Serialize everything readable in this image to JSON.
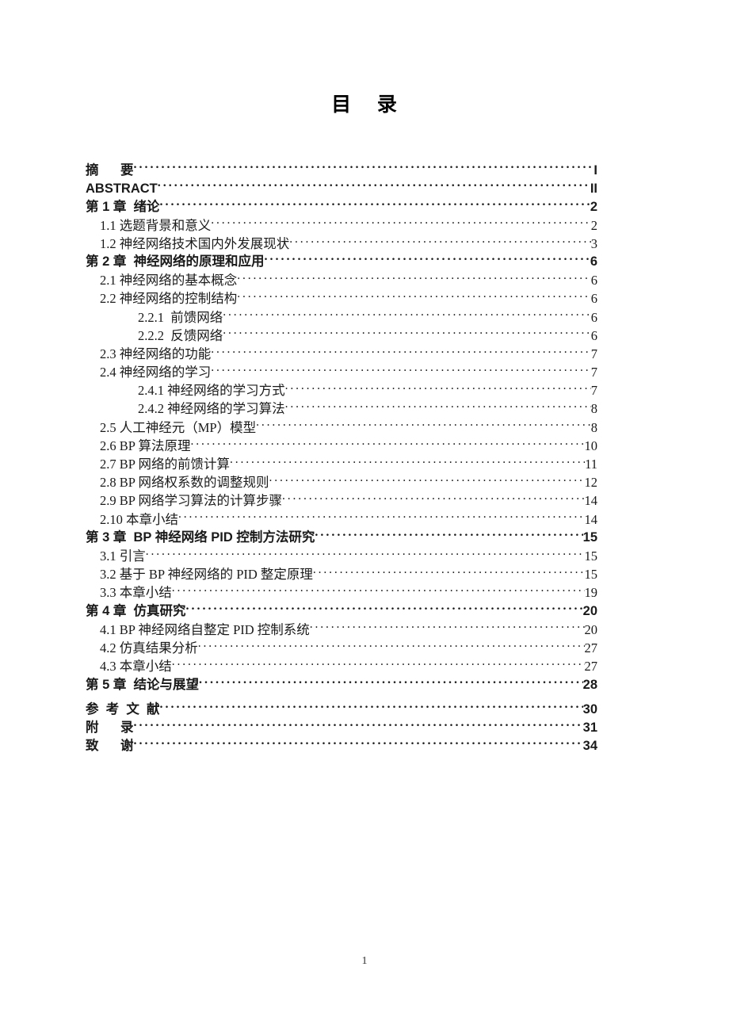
{
  "document": {
    "title": "目    录",
    "folio": "1"
  },
  "toc": {
    "entries": [
      {
        "label": "摘      要",
        "page": "I",
        "level": "front"
      },
      {
        "label": "ABSTRACT",
        "page": "II",
        "level": "front"
      },
      {
        "label": "第 1 章  绪论",
        "page": "2",
        "level": "1"
      },
      {
        "label": "1.1 选题背景和意义",
        "page": "2",
        "level": "2"
      },
      {
        "label": "1.2 神经网络技术国内外发展现状",
        "page": "3",
        "level": "2"
      },
      {
        "label": "第 2 章  神经网络的原理和应用",
        "page": "6",
        "level": "1"
      },
      {
        "label": "2.1 神经网络的基本概念",
        "page": "6",
        "level": "2"
      },
      {
        "label": "2.2 神经网络的控制结构",
        "page": "6",
        "level": "2"
      },
      {
        "label": "2.2.1  前馈网络",
        "page": "6",
        "level": "3"
      },
      {
        "label": "2.2.2  反馈网络",
        "page": "6",
        "level": "3"
      },
      {
        "label": "2.3 神经网络的功能",
        "page": "7",
        "level": "2"
      },
      {
        "label": "2.4 神经网络的学习",
        "page": "7",
        "level": "2"
      },
      {
        "label": "2.4.1 神经网络的学习方式",
        "page": "7",
        "level": "3"
      },
      {
        "label": "2.4.2 神经网络的学习算法",
        "page": "8",
        "level": "3"
      },
      {
        "label": "2.5 人工神经元（MP）模型",
        "page": "8",
        "level": "2"
      },
      {
        "label": "2.6 BP 算法原理",
        "page": "10",
        "level": "2"
      },
      {
        "label": "2.7 BP 网络的前馈计算",
        "page": "11",
        "level": "2"
      },
      {
        "label": "2.8 BP 网络权系数的调整规则",
        "page": "12",
        "level": "2"
      },
      {
        "label": "2.9 BP 网络学习算法的计算步骤",
        "page": "14",
        "level": "2"
      },
      {
        "label": "2.10 本章小结",
        "page": "14",
        "level": "2"
      },
      {
        "label": "第 3 章  BP 神经网络 PID 控制方法研究",
        "page": "15",
        "level": "1"
      },
      {
        "label": "3.1 引言",
        "page": "15",
        "level": "2"
      },
      {
        "label": "3.2 基于 BP 神经网络的 PID 整定原理",
        "page": "15",
        "level": "2"
      },
      {
        "label": "3.3 本章小结",
        "page": "19",
        "level": "2"
      },
      {
        "label": "第 4 章  仿真研究",
        "page": "20",
        "level": "1"
      },
      {
        "label": "4.1 BP 神经网络自整定 PID 控制系统",
        "page": "20",
        "level": "2"
      },
      {
        "label": "4.2 仿真结果分析",
        "page": "27",
        "level": "2"
      },
      {
        "label": "4.3 本章小结",
        "page": "27",
        "level": "2"
      },
      {
        "label": "第 5 章  结论与展望",
        "page": "28",
        "level": "1"
      },
      {
        "label": "参  考  文  献",
        "page": "30",
        "level": "back",
        "gap": true
      },
      {
        "label": "附      录",
        "page": "31",
        "level": "back"
      },
      {
        "label": "致      谢",
        "page": "34",
        "level": "back"
      }
    ]
  }
}
